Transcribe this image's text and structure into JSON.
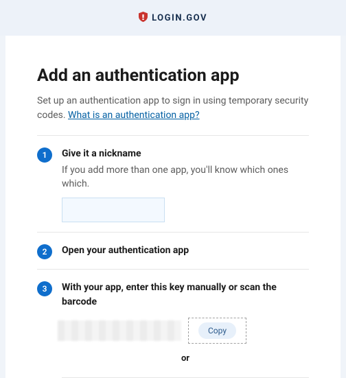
{
  "header": {
    "brand": "LOGIN.GOV"
  },
  "page": {
    "title": "Add an authentication app",
    "subtext_prefix": "Set up an authentication app to sign in using temporary security codes. ",
    "subtext_link": "What is an authentication app?"
  },
  "steps": [
    {
      "num": "1",
      "title": "Give it a nickname",
      "desc": "If you add more than one app, you'll know which ones which.",
      "input_value": ""
    },
    {
      "num": "2",
      "title": "Open your authentication app"
    },
    {
      "num": "3",
      "title": "With your app, enter this key manually or scan the barcode",
      "copy_label": "Copy",
      "or_label": "or"
    }
  ]
}
